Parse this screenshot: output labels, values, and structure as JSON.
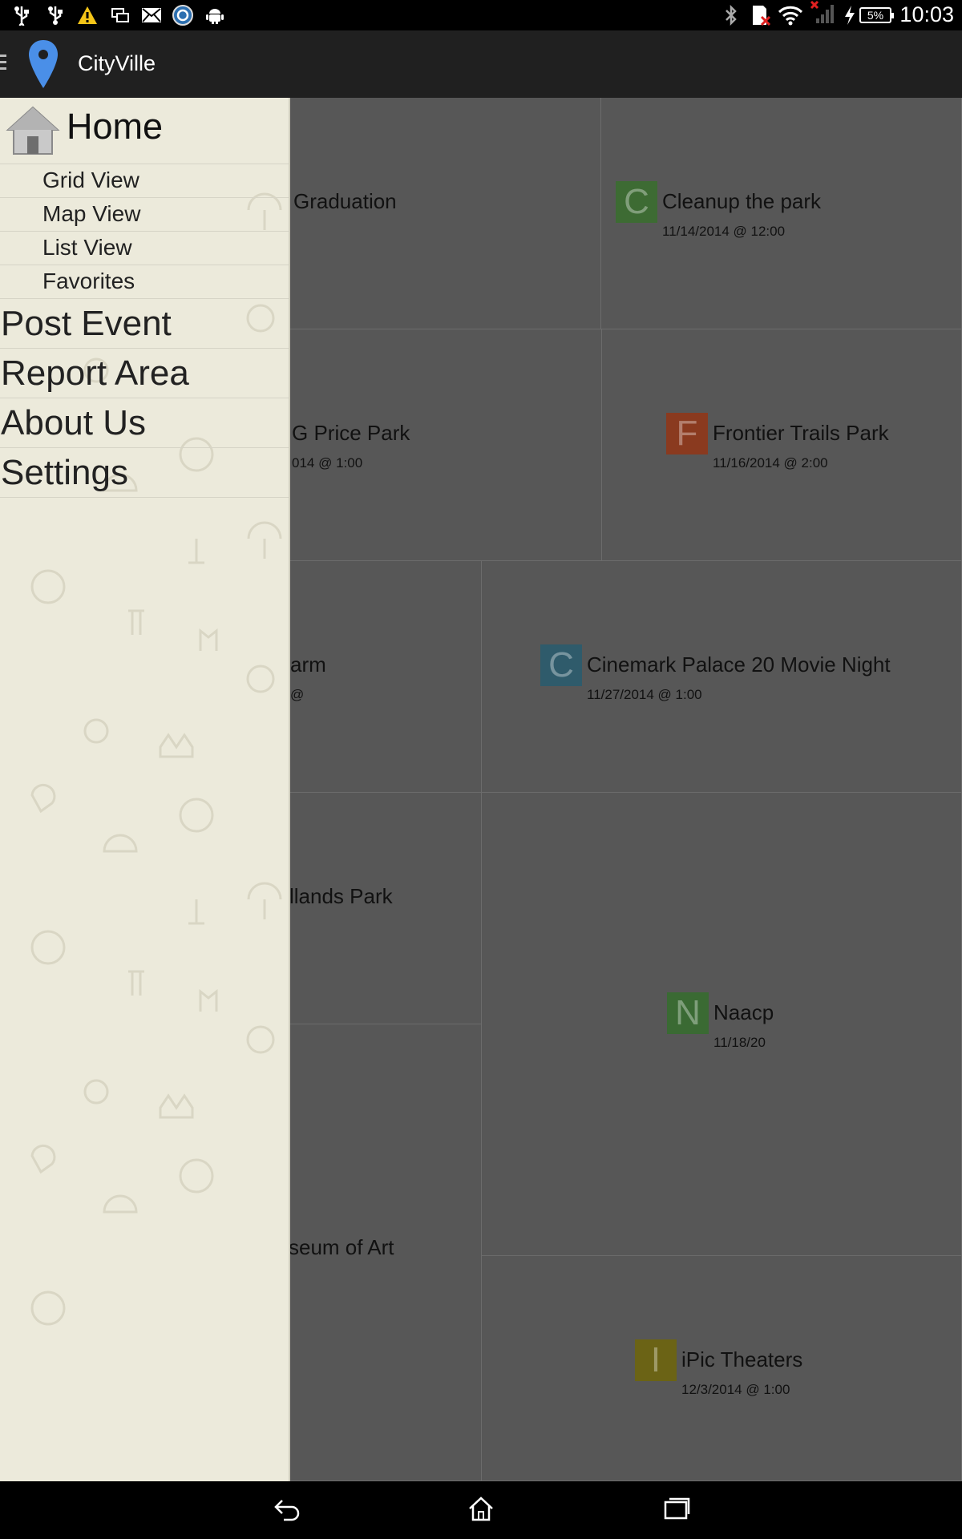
{
  "status_bar": {
    "time": "10:03",
    "battery": "5%",
    "left_icons": [
      "usb-icon",
      "usb-debug-icon",
      "warning-icon",
      "screen-mirror-icon",
      "mail-icon",
      "sync-icon",
      "android-icon"
    ],
    "right_icons": [
      "bluetooth-icon",
      "sd-card-error-icon",
      "wifi-icon",
      "no-signal-icon",
      "charging-icon",
      "battery-icon"
    ]
  },
  "action_bar": {
    "title": "CityVille",
    "logo_icon": "location-pin-icon",
    "logo_color": "#4a8fe8"
  },
  "drawer": {
    "home_label": "Home",
    "home_icon": "house-icon",
    "sub_items": [
      {
        "label": "Grid View"
      },
      {
        "label": "Map View"
      },
      {
        "label": "List View"
      },
      {
        "label": "Favorites"
      }
    ],
    "main_items": [
      {
        "label": "Post Event"
      },
      {
        "label": "Report Area"
      },
      {
        "label": "About Us"
      },
      {
        "label": "Settings"
      }
    ]
  },
  "events": [
    {
      "letter": "",
      "title": "Graduation",
      "date": "",
      "color": ""
    },
    {
      "letter": "C",
      "title": "Cleanup the park",
      "date": "11/14/2014 @ 12:00",
      "color": "#3d6b33"
    },
    {
      "letter": "",
      "title": "G Price Park",
      "date": "014 @ 1:00",
      "color": ""
    },
    {
      "letter": "F",
      "title": "Frontier Trails Park",
      "date": "11/16/2014 @ 2:00",
      "color": "#8a3a1f"
    },
    {
      "letter": "",
      "title": "arm",
      "date": "@",
      "color": ""
    },
    {
      "letter": "C",
      "title": "Cinemark Palace 20 Movie Night",
      "date": "11/27/2014 @ 1:00",
      "color": "#2f5b6b"
    },
    {
      "letter": "",
      "title": "llands Park",
      "date": "",
      "color": ""
    },
    {
      "letter": "N",
      "title": "Naacp",
      "date": "11/18/20",
      "color": "#3a6a33"
    },
    {
      "letter": "",
      "title": "seum of Art",
      "date": "",
      "color": ""
    },
    {
      "letter": "I",
      "title": "iPic Theaters",
      "date": "12/3/2014 @ 1:00",
      "color": "#6b6315"
    }
  ],
  "system_nav": [
    "back-icon",
    "home-nav-icon",
    "recent-apps-icon"
  ]
}
